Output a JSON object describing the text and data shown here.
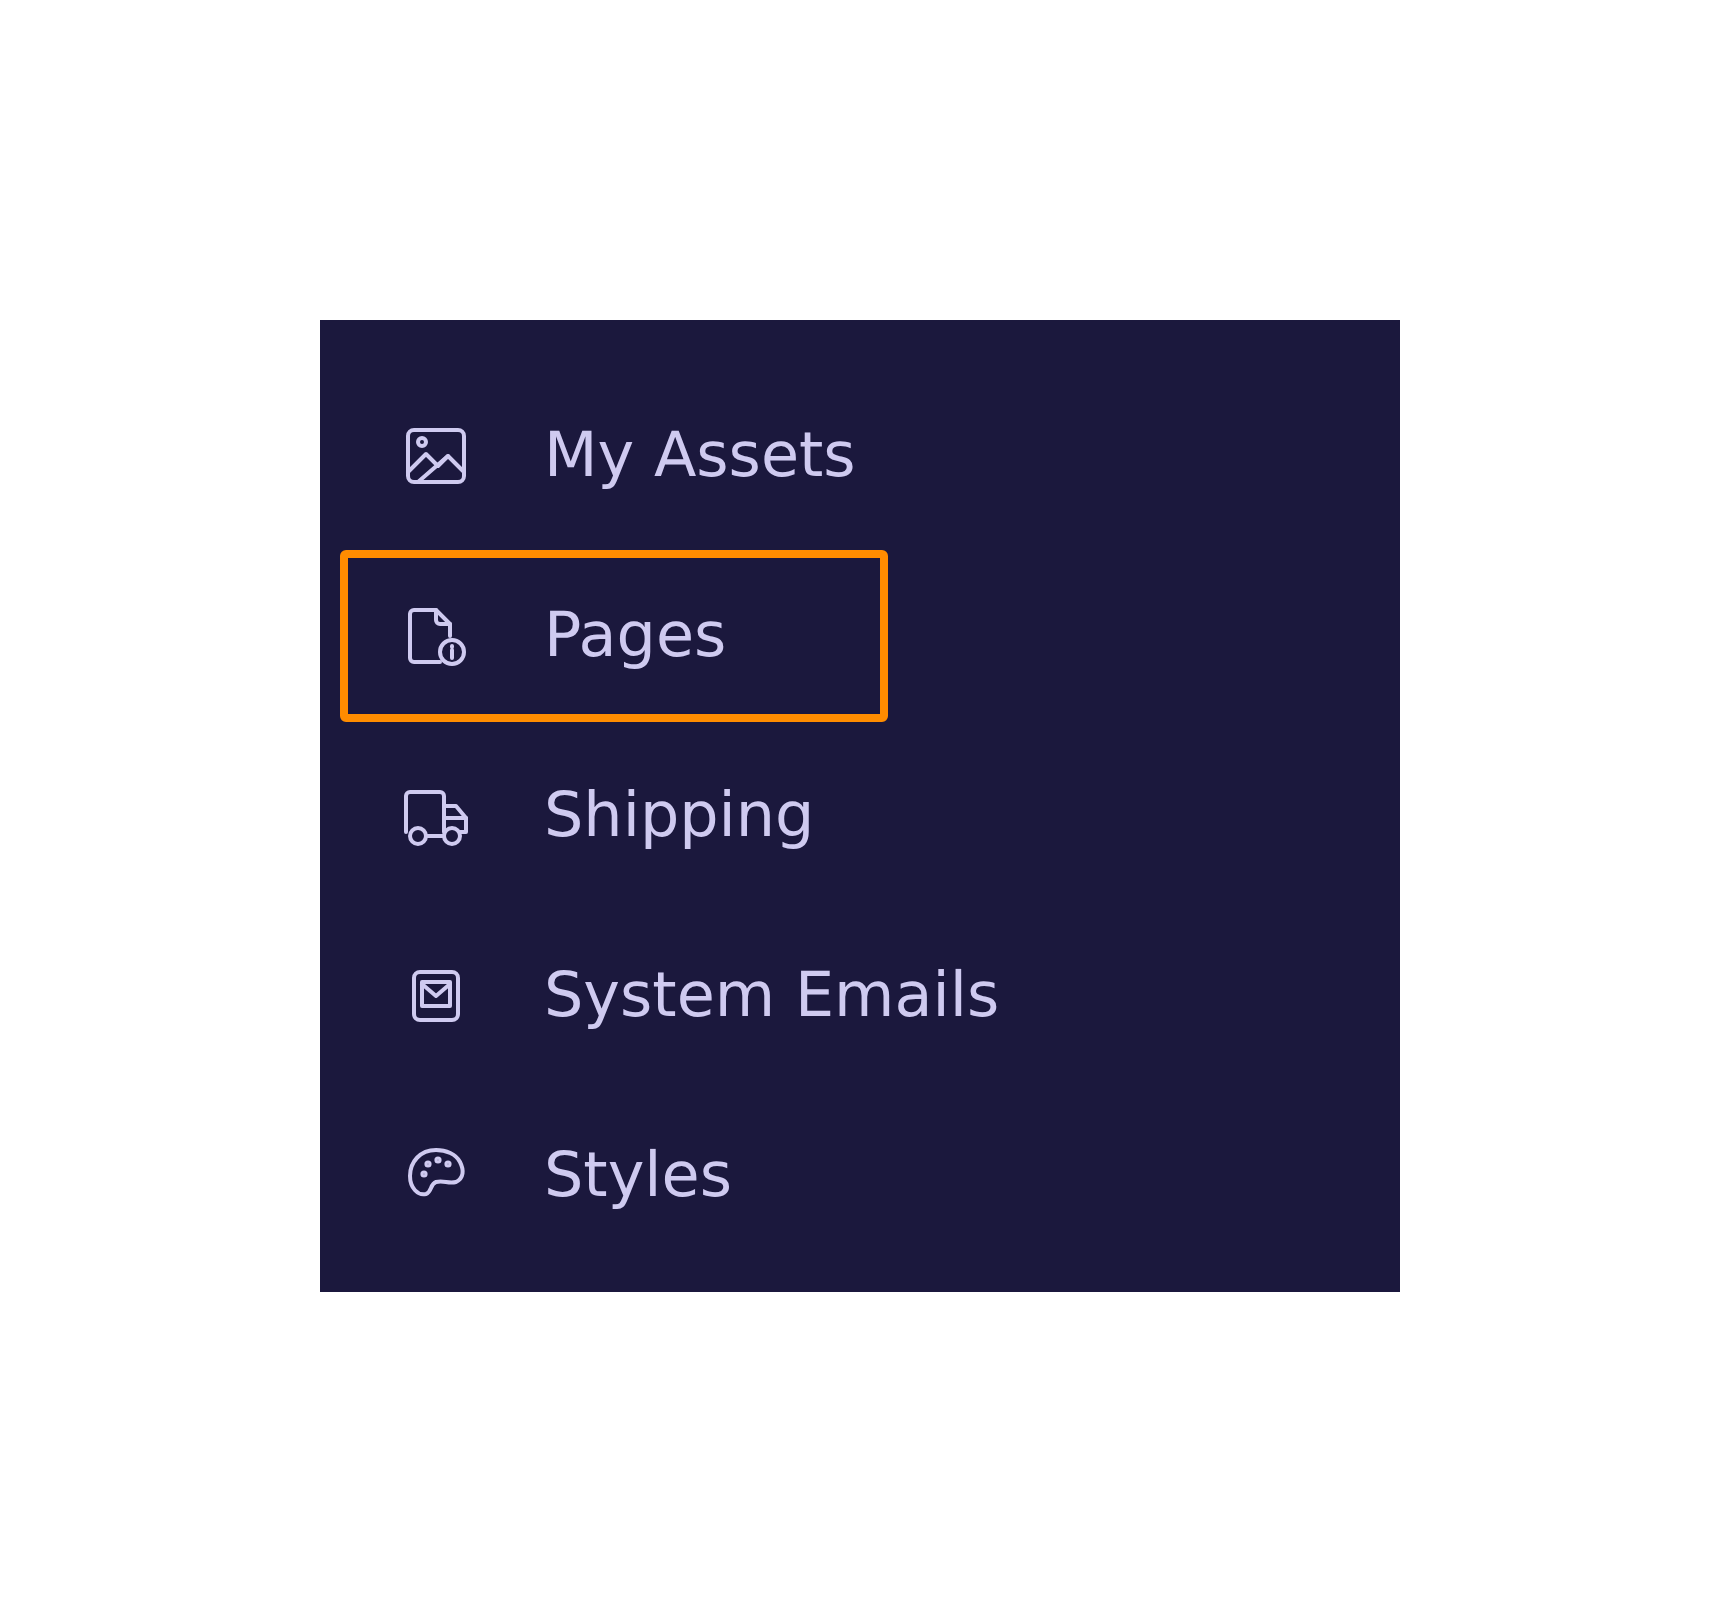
{
  "sidebar": {
    "items": [
      {
        "label": "My Assets",
        "kind": "image",
        "highlighted": false
      },
      {
        "label": "Pages",
        "kind": "page-info",
        "highlighted": true
      },
      {
        "label": "Shipping",
        "kind": "truck",
        "highlighted": false
      },
      {
        "label": "System Emails",
        "kind": "mail",
        "highlighted": false
      },
      {
        "label": "Styles",
        "kind": "palette",
        "highlighted": false
      }
    ]
  }
}
